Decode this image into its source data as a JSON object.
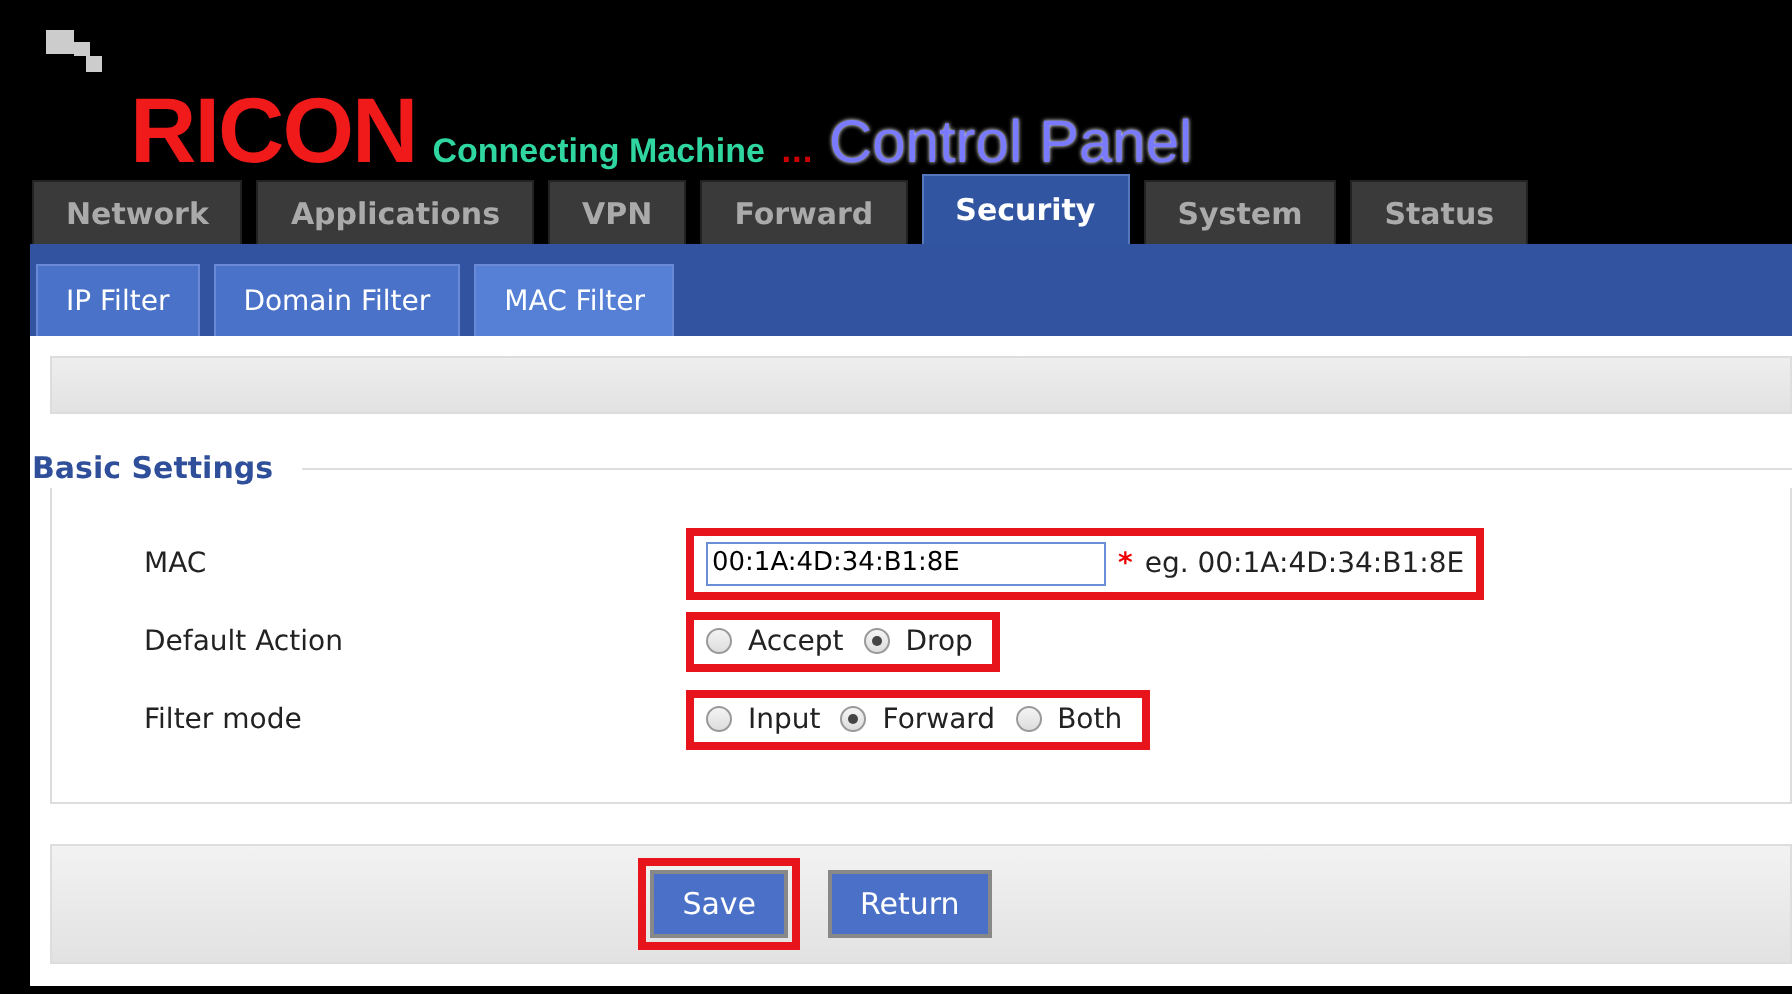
{
  "logo": {
    "brand": "RICON",
    "tagline": "Connecting Machine",
    "dots": "...",
    "title": "Control Panel"
  },
  "tabs": [
    {
      "label": "Network",
      "selected": false
    },
    {
      "label": "Applications",
      "selected": false
    },
    {
      "label": "VPN",
      "selected": false
    },
    {
      "label": "Forward",
      "selected": false
    },
    {
      "label": "Security",
      "selected": true
    },
    {
      "label": "System",
      "selected": false
    },
    {
      "label": "Status",
      "selected": false
    }
  ],
  "subtabs": [
    {
      "label": "IP Filter",
      "selected": false
    },
    {
      "label": "Domain Filter",
      "selected": false
    },
    {
      "label": "MAC Filter",
      "selected": true
    }
  ],
  "section": {
    "title": "Basic Settings"
  },
  "rows": [
    {
      "kind": "text",
      "label": "MAC",
      "value": "00:1A:4D:34:B1:8E",
      "required": "*",
      "hint": "eg. 00:1A:4D:34:B1:8E",
      "highlighted": true
    },
    {
      "kind": "radio",
      "label": "Default Action",
      "highlighted": true,
      "options": [
        {
          "label": "Accept",
          "selected": false
        },
        {
          "label": "Drop",
          "selected": true
        }
      ]
    },
    {
      "kind": "radio",
      "label": "Filter mode",
      "highlighted": true,
      "options": [
        {
          "label": "Input",
          "selected": false
        },
        {
          "label": "Forward",
          "selected": true
        },
        {
          "label": "Both",
          "selected": false
        }
      ]
    }
  ],
  "buttons": [
    {
      "label": "Save",
      "highlighted": true
    },
    {
      "label": "Return",
      "highlighted": false
    }
  ]
}
